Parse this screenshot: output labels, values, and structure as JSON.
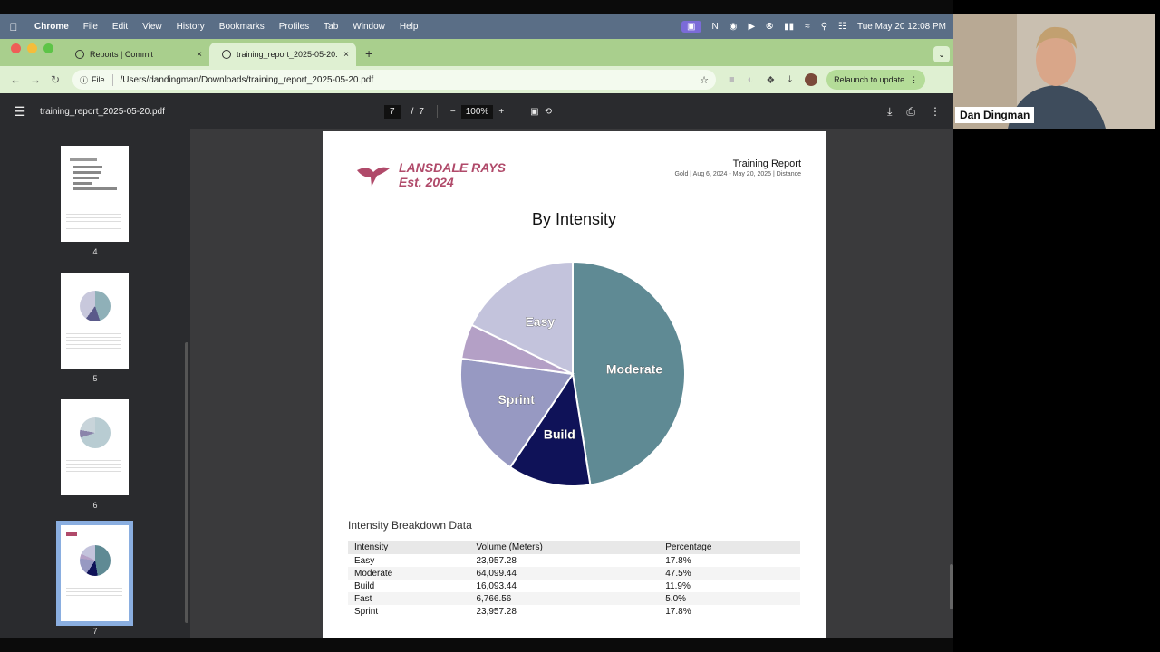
{
  "menubar": {
    "app": "Chrome",
    "items": [
      "File",
      "Edit",
      "View",
      "History",
      "Bookmarks",
      "Profiles",
      "Tab",
      "Window",
      "Help"
    ],
    "clock": "Tue May 20  12:08 PM"
  },
  "tabs": [
    {
      "title": "Reports | Commit",
      "close": "×"
    },
    {
      "title": "training_report_2025-05-20...",
      "close": "×"
    }
  ],
  "toolbar": {
    "scheme": "File",
    "url": "/Users/dandingman/Downloads/training_report_2025-05-20.pdf",
    "relaunch": "Relaunch to update"
  },
  "pdf": {
    "filename": "training_report_2025-05-20.pdf",
    "current_page": "7",
    "page_sep": "/",
    "total_pages": "7",
    "zoom": "100%"
  },
  "thumbnails": [
    "4",
    "5",
    "6",
    "7"
  ],
  "report": {
    "logo_line1": "LANSDALE RAYS",
    "logo_line2": "Est. 2024",
    "title": "Training Report",
    "subtitle": "Gold | Aug 6, 2024 - May 20, 2025 | Distance",
    "chart_title": "By Intensity",
    "table_title": "Intensity Breakdown Data",
    "table_headers": [
      "Intensity",
      "Volume (Meters)",
      "Percentage"
    ],
    "table_rows": [
      [
        "Easy",
        "23,957.28",
        "17.8%"
      ],
      [
        "Moderate",
        "64,099.44",
        "47.5%"
      ],
      [
        "Build",
        "16,093.44",
        "11.9%"
      ],
      [
        "Fast",
        "6,766.56",
        "5.0%"
      ],
      [
        "Sprint",
        "23,957.28",
        "17.8%"
      ]
    ]
  },
  "chart_data": {
    "type": "pie",
    "title": "By Intensity",
    "slices": [
      {
        "label": "Moderate",
        "value": 47.5,
        "color": "#5f8a94",
        "show_label": true
      },
      {
        "label": "Build",
        "value": 11.9,
        "color": "#0f1258",
        "show_label": true
      },
      {
        "label": "Sprint",
        "value": 17.8,
        "color": "#9799c2",
        "show_label": true
      },
      {
        "label": "Fast",
        "value": 5.0,
        "color": "#b4a0c6",
        "show_label": false
      },
      {
        "label": "Easy",
        "value": 17.8,
        "color": "#c3c3dc",
        "show_label": true
      }
    ],
    "start": "12 o'clock, clockwise"
  },
  "webcam": {
    "name": "Dan Dingman"
  },
  "colors": {
    "menubar": "#5a6e86",
    "tabstrip": "#a9cf8d",
    "toolbar": "#dff0d2",
    "viewer": "#2a2b2e",
    "brand": "#b04a6a"
  }
}
